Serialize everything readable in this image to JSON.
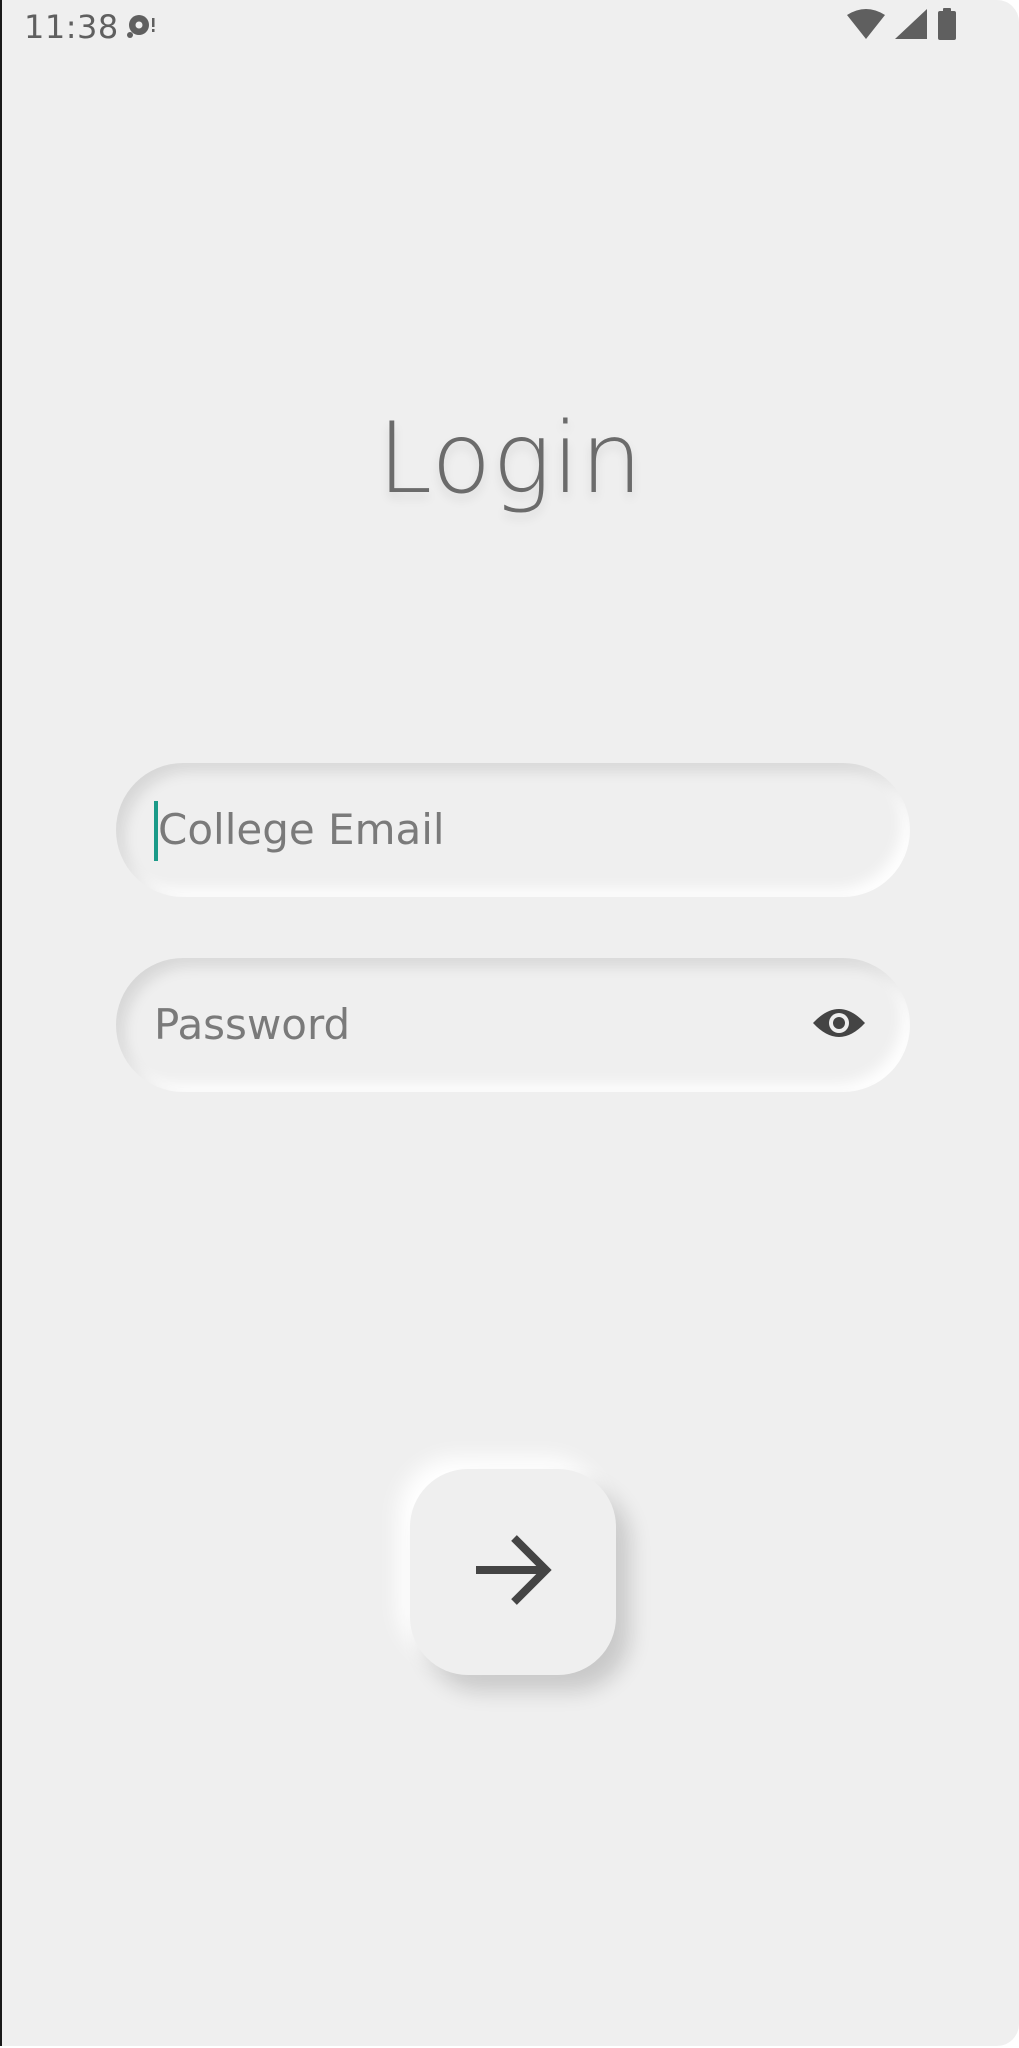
{
  "status_bar": {
    "time": "11:38",
    "media_icon": "media-notification-icon",
    "wifi_icon": "wifi-icon",
    "signal_icon": "cellular-signal-icon",
    "battery_icon": "battery-icon"
  },
  "screen": {
    "title": "Login",
    "email_field": {
      "placeholder": "College Email",
      "value": "",
      "focused": true
    },
    "password_field": {
      "placeholder": "Password",
      "value": "",
      "toggle_icon": "eye-icon"
    },
    "submit_button": {
      "icon": "arrow-right-icon"
    }
  },
  "colors": {
    "background": "#efefef",
    "text_secondary": "#7a7a7a",
    "title": "#6b6b6b",
    "caret_accent": "#1a9a88",
    "icon_dark": "#444444"
  }
}
